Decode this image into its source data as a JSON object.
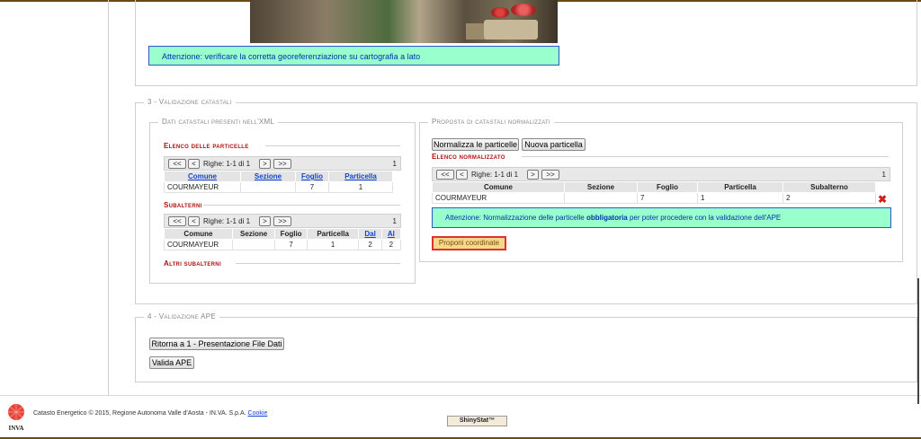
{
  "notice_top": "Attenzione: verificare la corretta georeferenziazione su cartografia a lato",
  "section3": {
    "legend": "3 - Validazione catastali",
    "left": {
      "legend": "Dati catastali presenti nell'XML",
      "particelle": {
        "title": "Elenco delle particelle",
        "pager": {
          "first": "<<",
          "prev": "<",
          "text": "Righe: 1-1 di 1",
          "next": ">",
          "last": ">>",
          "count": "1"
        },
        "headers": [
          "Comune",
          "Sezione",
          "Foglio",
          "Particella"
        ],
        "rows": [
          [
            "COURMAYEUR",
            "",
            "7",
            "1"
          ]
        ]
      },
      "subalterni": {
        "title": "Subalterni",
        "pager": {
          "first": "<<",
          "prev": "<",
          "text": "Righe: 1-1 di 1",
          "next": ">",
          "last": ">>",
          "count": "1"
        },
        "headers": [
          "Comune",
          "Sezione",
          "Foglio",
          "Particella",
          "Dal",
          "Al"
        ],
        "rows": [
          [
            "COURMAYEUR",
            "",
            "7",
            "1",
            "2",
            "2"
          ]
        ]
      },
      "altri": "Altri subalterni"
    },
    "right": {
      "legend": "Proposta di catastali normalizzati",
      "btn_normalizza": "Normalizza le particelle",
      "btn_nuova": "Nuova particella",
      "title": "Elenco normalizzato",
      "pager": {
        "first": "<<",
        "prev": "<",
        "text": "Righe: 1-1 di 1",
        "next": ">",
        "last": ">>",
        "count": "1"
      },
      "headers": [
        "Comune",
        "Sezione",
        "Foglio",
        "Particella",
        "Subalterno"
      ],
      "rows": [
        [
          "COURMAYEUR",
          "",
          "7",
          "1",
          "2"
        ]
      ],
      "notice_pre": "Attenzione: Normalizzazione delle particelle ",
      "notice_bold": "obbligatoria",
      "notice_post": " per poter procedere con la validazione dell'APE",
      "btn_proponi": "Proponi coordinate"
    }
  },
  "section4": {
    "legend": "4 - Validazione APE",
    "btn_ritorna": "Ritorna a 1 - Presentazione File Dati",
    "btn_valida": "Valida APE"
  },
  "footer": {
    "text": "Catasto Energetico © 2015, Regione Autonoma Valle d'Aosta - IN.VA. S.p.A.",
    "cookie": "Cookie",
    "logo_text": "INVA",
    "badge": "ShinyStat™"
  },
  "colors": {
    "notice_bg": "#99ffcc",
    "notice_border": "#3355cc",
    "accent_red": "#b01010",
    "delete": "#d02020"
  }
}
